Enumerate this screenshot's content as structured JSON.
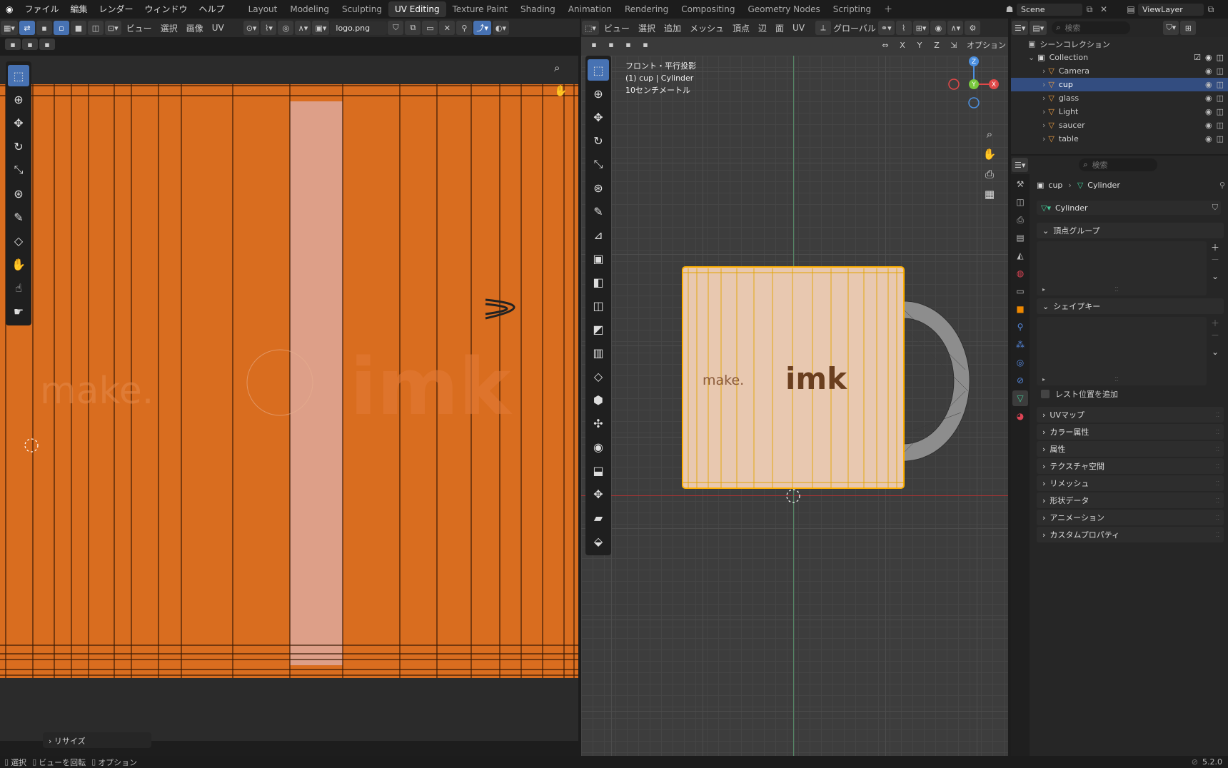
{
  "topbar": {
    "menus": [
      "ファイル",
      "編集",
      "レンダー",
      "ウィンドウ",
      "ヘルプ"
    ],
    "workspaces": [
      "Layout",
      "Modeling",
      "Sculpting",
      "UV Editing",
      "Texture Paint",
      "Shading",
      "Animation",
      "Rendering",
      "Compositing",
      "Geometry Nodes",
      "Scripting"
    ],
    "active_workspace": "UV Editing",
    "scene": "Scene",
    "view_layer": "ViewLayer"
  },
  "uv_editor": {
    "menus": [
      "ビュー",
      "選択",
      "画像",
      "UV"
    ],
    "image_name": "logo.png",
    "texture_text_left": "make.",
    "texture_text_right": "imk",
    "last_op": "リサイズ"
  },
  "viewport": {
    "menus": [
      "ビュー",
      "選択",
      "追加",
      "メッシュ",
      "頂点",
      "辺",
      "面",
      "UV"
    ],
    "orientation": "グローバル",
    "options_label": "オプション",
    "axes": [
      "X",
      "Y",
      "Z"
    ],
    "info_view": "フロント・平行投影",
    "info_object": "(1) cup | Cylinder",
    "info_scale": "10センチメートル",
    "mug_text_left": "make.",
    "mug_text_right": "imk"
  },
  "outliner": {
    "search_placeholder": "検索",
    "scene_collection": "シーンコレクション",
    "collection": "Collection",
    "items": [
      {
        "name": "Camera",
        "selected": false
      },
      {
        "name": "cup",
        "selected": true
      },
      {
        "name": "glass",
        "selected": false
      },
      {
        "name": "Light",
        "selected": false
      },
      {
        "name": "saucer",
        "selected": false
      },
      {
        "name": "table",
        "selected": false
      }
    ]
  },
  "properties": {
    "search_placeholder": "検索",
    "breadcrumb_object": "cup",
    "breadcrumb_data": "Cylinder",
    "datablock": "Cylinder",
    "vertex_groups": "頂点グループ",
    "shape_keys": "シェイプキー",
    "relative_label": "レスト位置を追加",
    "panels": [
      "UVマップ",
      "カラー属性",
      "属性",
      "テクスチャ空間",
      "リメッシュ",
      "形状データ",
      "アニメーション",
      "カスタムプロパティ"
    ]
  },
  "statusbar": {
    "select": "選択",
    "rotate_view": "ビューを回転",
    "options": "オプション",
    "version": "5.2.0"
  },
  "colors": {
    "accent": "#4772b3",
    "uv_orange": "#d96d1f",
    "selection": "#ffaa00",
    "mug": "#e8c8b0"
  }
}
